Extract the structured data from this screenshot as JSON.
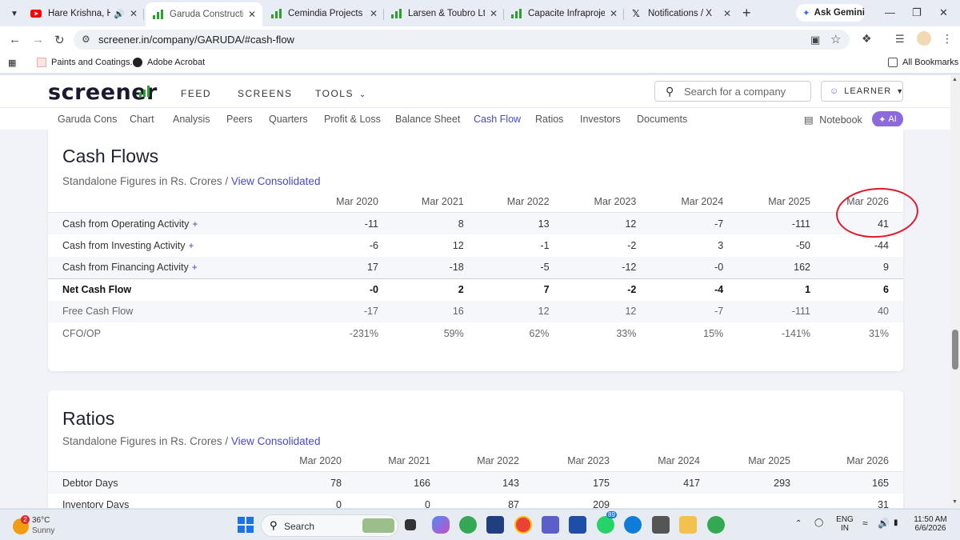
{
  "browser": {
    "tabs": [
      {
        "title": "Hare Krishna, Hare",
        "favicon": "youtube-icon",
        "active": false
      },
      {
        "title": "Garuda Construction a",
        "favicon": "screener-icon",
        "active": true
      },
      {
        "title": "Cemindia Projects Ltd",
        "favicon": "screener-icon",
        "active": false
      },
      {
        "title": "Larsen & Toubro Ltd sl",
        "favicon": "screener-icon",
        "active": false
      },
      {
        "title": "Capacite Infraprojects",
        "favicon": "screener-icon",
        "active": false
      },
      {
        "title": "Notifications / X",
        "favicon": "x-icon",
        "active": false
      }
    ],
    "ask_gemini": "Ask Gemini",
    "url": "screener.in/company/GARUDA/#cash-flow",
    "bookmarks": [
      {
        "label": "Paints and Coatings..."
      },
      {
        "label": "Adobe Acrobat"
      }
    ],
    "all_bookmarks": "All Bookmarks"
  },
  "site": {
    "logo": "screener",
    "nav": [
      "FEED",
      "SCREENS",
      "TOOLS"
    ],
    "search_placeholder": "Search for a company",
    "user_button": "LEARNER",
    "subnav": [
      "Garuda Cons",
      "Chart",
      "Analysis",
      "Peers",
      "Quarters",
      "Profit & Loss",
      "Balance Sheet",
      "Cash Flow",
      "Ratios",
      "Investors",
      "Documents"
    ],
    "subnav_active": "Cash Flow",
    "notebook": "Notebook",
    "ai": "AI"
  },
  "cash_flows": {
    "title": "Cash Flows",
    "subtitle": "Standalone Figures in Rs. Crores /",
    "link": "View Consolidated",
    "columns": [
      "Mar 2020",
      "Mar 2021",
      "Mar 2022",
      "Mar 2023",
      "Mar 2024",
      "Mar 2025",
      "Mar 2026"
    ],
    "rows": [
      {
        "label": "Cash from Operating Activity",
        "expandable": true,
        "values": [
          "-11",
          "8",
          "13",
          "12",
          "-7",
          "-111",
          "41"
        ]
      },
      {
        "label": "Cash from Investing Activity",
        "expandable": true,
        "values": [
          "-6",
          "12",
          "-1",
          "-2",
          "3",
          "-50",
          "-44"
        ]
      },
      {
        "label": "Cash from Financing Activity",
        "expandable": true,
        "values": [
          "17",
          "-18",
          "-5",
          "-12",
          "-0",
          "162",
          "9"
        ]
      },
      {
        "label": "Net Cash Flow",
        "expandable": false,
        "values": [
          "-0",
          "2",
          "7",
          "-2",
          "-4",
          "1",
          "6"
        ]
      },
      {
        "label": "Free Cash Flow",
        "expandable": false,
        "values": [
          "-17",
          "16",
          "12",
          "12",
          "-7",
          "-111",
          "40"
        ]
      },
      {
        "label": "CFO/OP",
        "expandable": false,
        "values": [
          "-231%",
          "59%",
          "62%",
          "33%",
          "15%",
          "-141%",
          "31%"
        ]
      }
    ],
    "expand_symbol": "+"
  },
  "ratios": {
    "title": "Ratios",
    "subtitle": "Standalone Figures in Rs. Crores /",
    "link": "View Consolidated",
    "columns": [
      "Mar 2020",
      "Mar 2021",
      "Mar 2022",
      "Mar 2023",
      "Mar 2024",
      "Mar 2025",
      "Mar 2026"
    ],
    "rows": [
      {
        "label": "Debtor Days",
        "values": [
          "78",
          "166",
          "143",
          "175",
          "417",
          "293",
          "165"
        ]
      },
      {
        "label": "Inventory Days",
        "values": [
          "0",
          "0",
          "87",
          "209",
          "",
          "",
          "31"
        ]
      }
    ]
  },
  "taskbar": {
    "weather_temp": "36°C",
    "weather_desc": "Sunny",
    "weather_badge": "2",
    "search": "Search",
    "whatsapp_badge": "89",
    "lang": "ENG",
    "region": "IN",
    "time": "11:50 AM",
    "date": "6/6/2026"
  },
  "colors": {
    "accent": "#4848c8",
    "annotation": "#e0182d",
    "ai_pill": "#8d6ad9"
  }
}
